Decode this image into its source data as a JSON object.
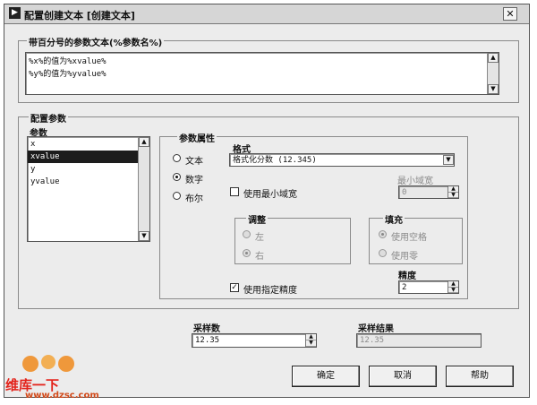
{
  "window": {
    "title": "配置创建文本 [创建文本]"
  },
  "text_group": {
    "label": "带百分号的参数文本(%参数名%)",
    "lines": [
      "%x%的值为%xvalue%",
      "%y%的值为%yvalue%"
    ]
  },
  "config_group": {
    "label": "配置参数",
    "params_label": "参数",
    "params": [
      "x",
      "xvalue",
      "y",
      "yvalue"
    ],
    "selected_index": 1
  },
  "attr_group": {
    "label": "参数属性",
    "type_options": [
      "文本",
      "数字",
      "布尔"
    ],
    "type_selected": "数字",
    "format_label": "格式",
    "format_value": "格式化分数 (12.345)",
    "min_width_label": "使用最小域宽",
    "min_width_checked": false,
    "min_width_field_label": "最小域宽",
    "min_width_value": "0",
    "adjust_label": "调整",
    "adjust_options": [
      "左",
      "右"
    ],
    "adjust_selected": "右",
    "fill_label": "填充",
    "fill_options": [
      "使用空格",
      "使用零"
    ],
    "fill_selected": "使用空格",
    "precision_check_label": "使用指定精度",
    "precision_checked": true,
    "precision_label": "精度",
    "precision_value": "2"
  },
  "sample": {
    "label": "采样数",
    "value": "12.35",
    "result_label": "采样结果",
    "result_value": "12.35"
  },
  "buttons": {
    "ok": "确定",
    "cancel": "取消",
    "help": "帮助"
  },
  "watermark": {
    "brand": "维库一下",
    "url": "www.dzsc.com"
  }
}
